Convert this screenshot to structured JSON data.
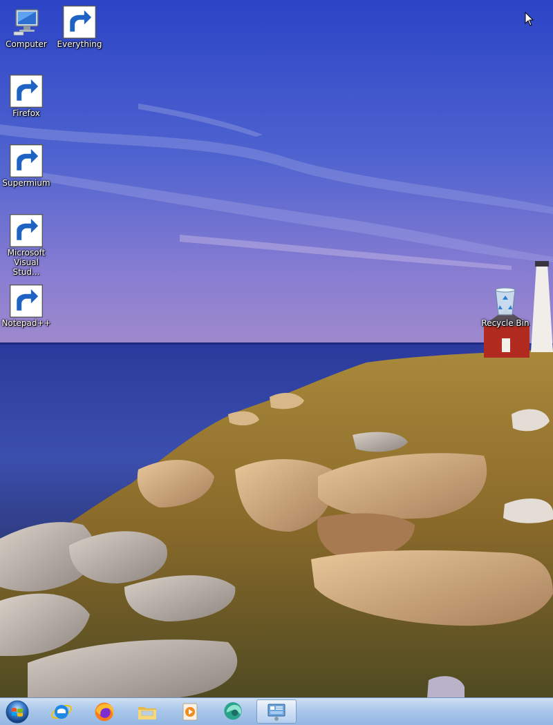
{
  "desktop": {
    "icons": [
      {
        "label": "Computer"
      },
      {
        "label": "Everything"
      },
      {
        "label": "Firefox"
      },
      {
        "label": "Supermium"
      },
      {
        "label": "Microsoft Visual Stud..."
      },
      {
        "label": "Notepad++"
      },
      {
        "label": "Recycle Bin"
      }
    ]
  },
  "taskbar": {
    "pinned": [
      {
        "icon": "internet-explorer-icon"
      },
      {
        "icon": "firefox-icon"
      },
      {
        "icon": "file-explorer-icon"
      },
      {
        "icon": "media-player-icon"
      },
      {
        "icon": "supermium-icon"
      },
      {
        "icon": "control-panel-icon"
      }
    ]
  },
  "colors": {
    "sky_top": "#2e46c8",
    "sky_bottom": "#8a7fd0",
    "sea": "#2a3e9a",
    "taskbar": "#a9c7ea"
  }
}
